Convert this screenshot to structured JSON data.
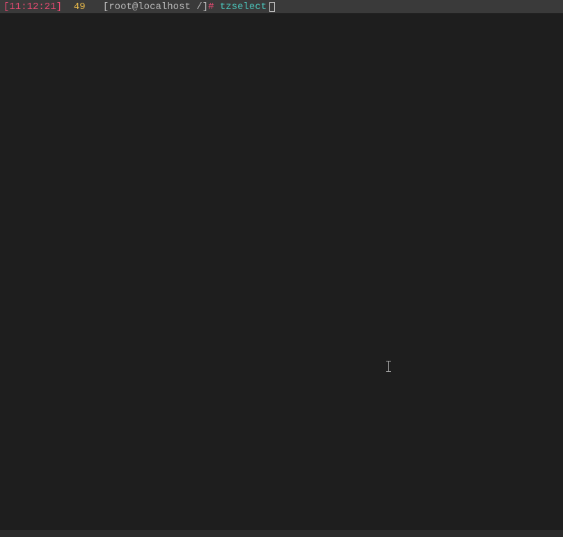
{
  "prompt": {
    "timestamp": "[11:12:21]",
    "history_number": "49",
    "user_host_path": "[root@localhost /]",
    "hash": "#",
    "command": "tzselect"
  },
  "colors": {
    "timestamp": "#e84a72",
    "history": "#e8b94a",
    "path": "#b8b8b8",
    "hash": "#e84a72",
    "command": "#4ac2b8",
    "prompt_bg": "#3a3a3a",
    "terminal_bg": "#1e1e1e"
  }
}
